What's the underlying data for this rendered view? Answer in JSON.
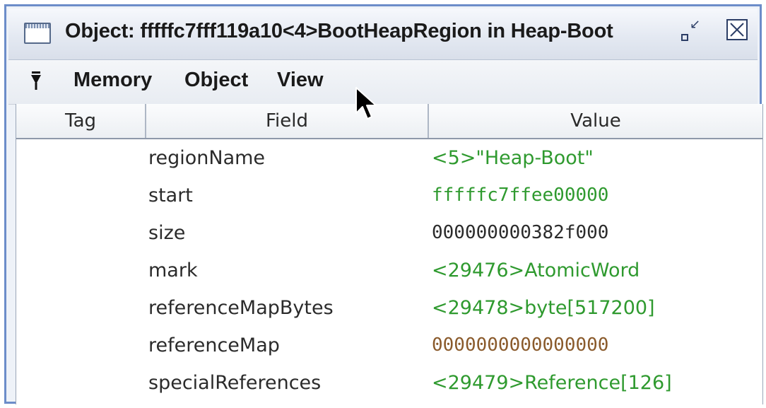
{
  "window": {
    "title": "Object: fffffc7fff119a10<4>BootHeapRegion in Heap-Boot",
    "colors": {
      "border": "#6c8dc9",
      "link_green": "#2f9a2f",
      "plain_text": "#2b2b2b",
      "brown": "#8a5a2b"
    }
  },
  "menubar": {
    "items": [
      {
        "label": "Memory"
      },
      {
        "label": "Object"
      },
      {
        "label": "View"
      }
    ]
  },
  "table": {
    "columns": [
      "Tag",
      "Field",
      "Value"
    ],
    "rows": [
      {
        "field": "regionName",
        "value": "<5>\"Heap-Boot\"",
        "color": "#2f9a2f"
      },
      {
        "field": "start",
        "value": "fffffc7ffee00000",
        "color": "#2f9a2f"
      },
      {
        "field": "size",
        "value": "000000000382f000",
        "color": "#2b2b2b"
      },
      {
        "field": "mark",
        "value": "<29476>AtomicWord",
        "color": "#2f9a2f"
      },
      {
        "field": "referenceMapBytes",
        "value": "<29478>byte[517200]",
        "color": "#2f9a2f"
      },
      {
        "field": "referenceMap",
        "value": "0000000000000000",
        "color": "#8a5a2b"
      },
      {
        "field": "specialReferences",
        "value": "<29479>Reference[126]",
        "color": "#2f9a2f"
      }
    ]
  },
  "icons": {
    "window": "window-icon",
    "restore": "restore-icon",
    "close": "close-icon",
    "menu": "dropdown-arrow-icon",
    "cursor": "mouse-pointer-icon"
  }
}
